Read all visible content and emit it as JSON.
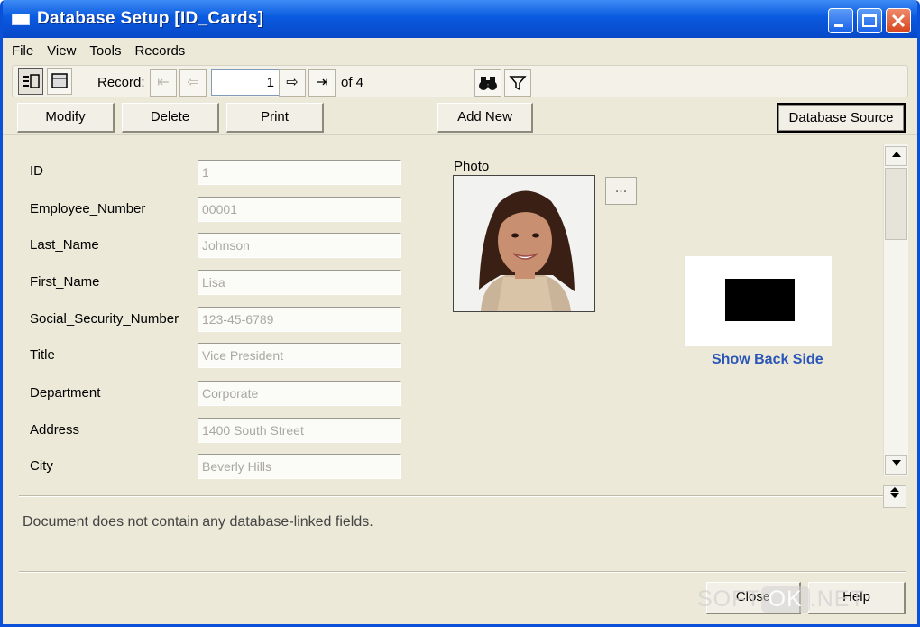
{
  "window": {
    "title": "Database Setup [ID_Cards]"
  },
  "menu": [
    "File",
    "View",
    "Tools",
    "Records"
  ],
  "toolbar": {
    "record_label": "Record:",
    "record_value": "1",
    "of_label": "of 4",
    "first_glyph": "⇤",
    "prev_glyph": "⇦",
    "next_glyph": "⇨",
    "last_glyph": "⇥"
  },
  "buttons": {
    "modify": "Modify",
    "delete": "Delete",
    "print": "Print",
    "add_new": "Add New",
    "database_source": "Database Source"
  },
  "fields": [
    {
      "label": "ID",
      "value": "1"
    },
    {
      "label": "Employee_Number",
      "value": "00001"
    },
    {
      "label": "Last_Name",
      "value": "Johnson"
    },
    {
      "label": "First_Name",
      "value": "Lisa"
    },
    {
      "label": "Social_Security_Number",
      "value": "123-45-6789"
    },
    {
      "label": "Title",
      "value": "Vice President"
    },
    {
      "label": "Department",
      "value": "Corporate"
    },
    {
      "label": "Address",
      "value": "1400 South Street"
    },
    {
      "label": "City",
      "value": "Beverly Hills"
    }
  ],
  "photo": {
    "label": "Photo",
    "browse_label": "..."
  },
  "card": {
    "show_back": "Show Back Side"
  },
  "status": "Document does not contain any database-linked fields.",
  "bottom": {
    "close": "Close",
    "help": "Help"
  },
  "watermark": {
    "left": "SOFT",
    "ok": "OK",
    "right": ".NET"
  },
  "colors": {
    "titlebar": "#0a5ae0",
    "link": "#2a55b8",
    "background": "#ece9d8"
  }
}
